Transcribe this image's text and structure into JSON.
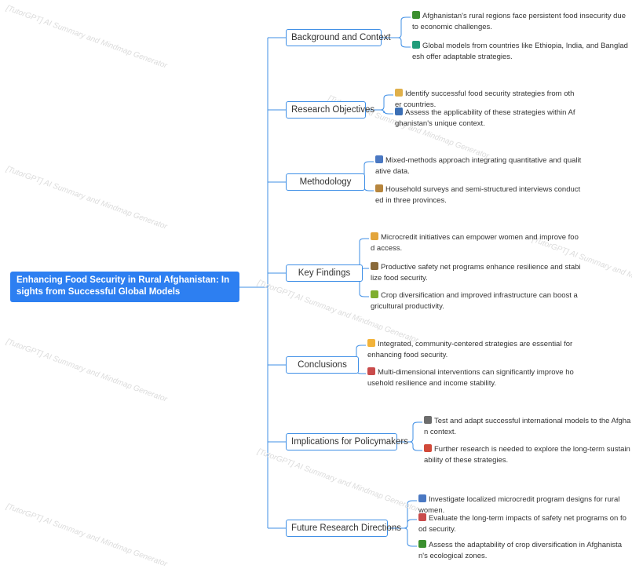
{
  "watermark": "[TutorGPT] AI Summary and Mindmap Generator",
  "root": {
    "title": "Enhancing Food Security in Rural Afghanistan: Insights from Successful Global Models"
  },
  "branches": [
    {
      "label": "Background and Context",
      "items": [
        {
          "icon": "plant-icon",
          "text": "Afghanistan's rural regions face persistent food insecurity due to economic challenges."
        },
        {
          "icon": "globe-icon",
          "text": "Global models from countries like Ethiopia, India, and Bangladesh offer adaptable strategies."
        }
      ]
    },
    {
      "label": "Research Objectives",
      "items": [
        {
          "icon": "memo-icon",
          "text": "Identify successful food security strategies from other countries."
        },
        {
          "icon": "bar-chart-icon",
          "text": "Assess the applicability of these strategies within Afghanistan's unique context."
        }
      ]
    },
    {
      "label": "Methodology",
      "items": [
        {
          "icon": "magnifier-icon",
          "text": "Mixed-methods approach integrating quantitative and qualitative data."
        },
        {
          "icon": "clipboard-icon",
          "text": "Household surveys and semi-structured interviews conducted in three provinces."
        }
      ]
    },
    {
      "label": "Key Findings",
      "items": [
        {
          "icon": "money-bag-icon",
          "text": "Microcredit initiatives can empower women and improve food access."
        },
        {
          "icon": "tools-icon",
          "text": "Productive safety net programs enhance resilience and stabilize food security."
        },
        {
          "icon": "crop-icon",
          "text": "Crop diversification and improved infrastructure can boost agricultural productivity."
        }
      ]
    },
    {
      "label": "Conclusions",
      "items": [
        {
          "icon": "heart-icon",
          "text": "Integrated, community-centered strategies are essential for enhancing food security."
        },
        {
          "icon": "chart-up-icon",
          "text": "Multi-dimensional interventions can significantly improve household resilience and income stability."
        }
      ]
    },
    {
      "label": "Implications for Policymakers",
      "items": [
        {
          "icon": "bank-icon",
          "text": "Test and adapt successful international models to the Afghan context."
        },
        {
          "icon": "calendar-icon",
          "text": "Further research is needed to explore the long-term sustainability of these strategies."
        }
      ]
    },
    {
      "label": "Future Research Directions",
      "items": [
        {
          "icon": "magnifier-icon",
          "text": "Investigate localized microcredit program designs for rural women."
        },
        {
          "icon": "chart-up-icon",
          "text": "Evaluate the long-term impacts of safety net programs on food security."
        },
        {
          "icon": "plant-icon",
          "text": "Assess the adaptability of crop diversification in Afghanistan's ecological zones."
        }
      ]
    }
  ],
  "icon_colors": {
    "plant-icon": "#3a8f2e",
    "globe-icon": "#1f9c7a",
    "memo-icon": "#e0b04a",
    "bar-chart-icon": "#3b6fb5",
    "magnifier-icon": "#4a78c2",
    "clipboard-icon": "#b7863e",
    "money-bag-icon": "#e3a53b",
    "tools-icon": "#8a6a3a",
    "crop-icon": "#7fae2f",
    "heart-icon": "#f2b33a",
    "chart-up-icon": "#c94b4b",
    "bank-icon": "#6d6d6d",
    "calendar-icon": "#d14a3a"
  }
}
